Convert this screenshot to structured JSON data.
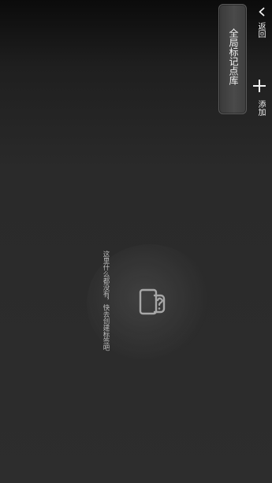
{
  "header": {
    "back_label": "返回",
    "title": "全局标记点库",
    "add_label": "添加"
  },
  "empty_state": {
    "message": "这里什么都没有，快去创建标签吧"
  },
  "icons": {
    "back": "chevron-left-icon",
    "add": "plus-icon",
    "empty": "document-question-icon"
  },
  "colors": {
    "text": "#f2f2f2",
    "muted": "#bdbdbd"
  }
}
